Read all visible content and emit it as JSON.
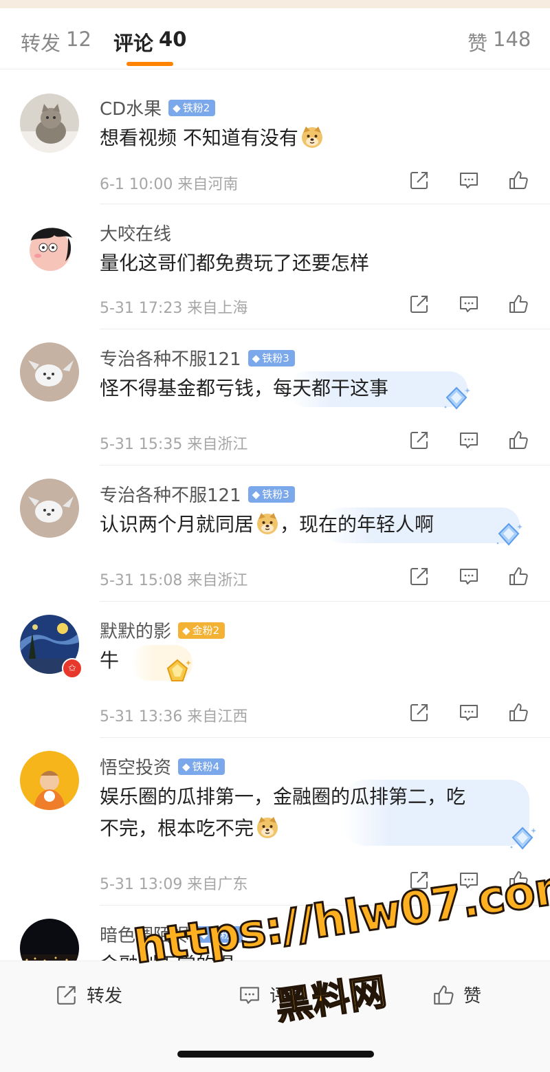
{
  "tabs": {
    "repost_label": "转发",
    "repost_count": "12",
    "comment_label": "评论",
    "comment_count": "40",
    "like_label": "赞",
    "like_count": "148"
  },
  "comments": [
    {
      "user": "CD水果",
      "badge": "铁粉2",
      "badge_type": "iron",
      "text": "想看视频 不知道有没有",
      "time": "6-1 10:00",
      "location": "来自河南"
    },
    {
      "user": "大咬在线",
      "badge": "",
      "text": "量化这哥们都免费玩了还要怎样",
      "time": "5-31 17:23",
      "location": "来自上海"
    },
    {
      "user": "专治各种不服121",
      "badge": "铁粉3",
      "badge_type": "iron",
      "text": "怪不得基金都亏钱，每天都干这事",
      "time": "5-31 15:35",
      "location": "来自浙江"
    },
    {
      "user": "专治各种不服121",
      "badge": "铁粉3",
      "badge_type": "iron",
      "text_a": "认识两个月就同居",
      "text_b": "，现在的年轻人啊",
      "time": "5-31 15:08",
      "location": "来自浙江"
    },
    {
      "user": "默默的影",
      "badge": "金粉2",
      "badge_type": "gold",
      "text": "牛",
      "time": "5-31 13:36",
      "location": "来自江西"
    },
    {
      "user": "悟空投资",
      "badge": "铁粉4",
      "badge_type": "iron",
      "text_line1": "娱乐圈的瓜排第一，金融圈的瓜排第二，吃",
      "text_line2": "不完，根本吃不完",
      "time": "5-31 13:09",
      "location": "来自广东"
    },
    {
      "user": "暗色调陌烬",
      "badge": "铁粉5",
      "badge_type": "iron",
      "text": "金融刮天常的得"
    }
  ],
  "bottom_bar": {
    "repost": "转发",
    "comment": "评论",
    "like": "赞"
  },
  "watermark": {
    "line1": "https://hlw07.com",
    "line2": "黑料网"
  },
  "colors": {
    "accent": "#ff8200",
    "iron_badge": "#7aa8ea",
    "gold_badge": "#f3b234"
  }
}
